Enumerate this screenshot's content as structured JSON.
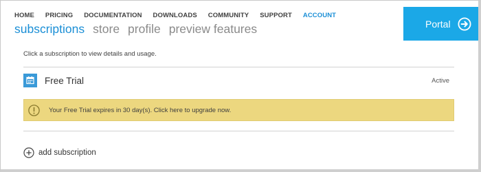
{
  "topnav": {
    "items": [
      {
        "label": "HOME"
      },
      {
        "label": "PRICING"
      },
      {
        "label": "DOCUMENTATION"
      },
      {
        "label": "DOWNLOADS"
      },
      {
        "label": "COMMUNITY"
      },
      {
        "label": "SUPPORT"
      },
      {
        "label": "ACCOUNT"
      }
    ],
    "active": "ACCOUNT"
  },
  "subnav": {
    "items": [
      {
        "label": "subscriptions"
      },
      {
        "label": "store"
      },
      {
        "label": "profile"
      },
      {
        "label": "preview features"
      }
    ],
    "active": "subscriptions"
  },
  "portal": {
    "label": "Portal",
    "icon": "arrow-right-circle-icon"
  },
  "main": {
    "hint": "Click a subscription to view details and usage.",
    "subscription": {
      "name": "Free Trial",
      "status": "Active",
      "icon": "calendar-icon"
    },
    "warning": {
      "text": "Your Free Trial expires in 30 day(s). Click here to upgrade now.",
      "icon": "warning-icon"
    },
    "add": {
      "label": "add subscription",
      "icon": "plus-circle-icon"
    }
  },
  "colors": {
    "accent": "#1b8fd6",
    "portal_bg": "#1ba8e7",
    "warning_bg": "#ecd77f",
    "subscription_icon_bg": "#3a9ad8"
  }
}
